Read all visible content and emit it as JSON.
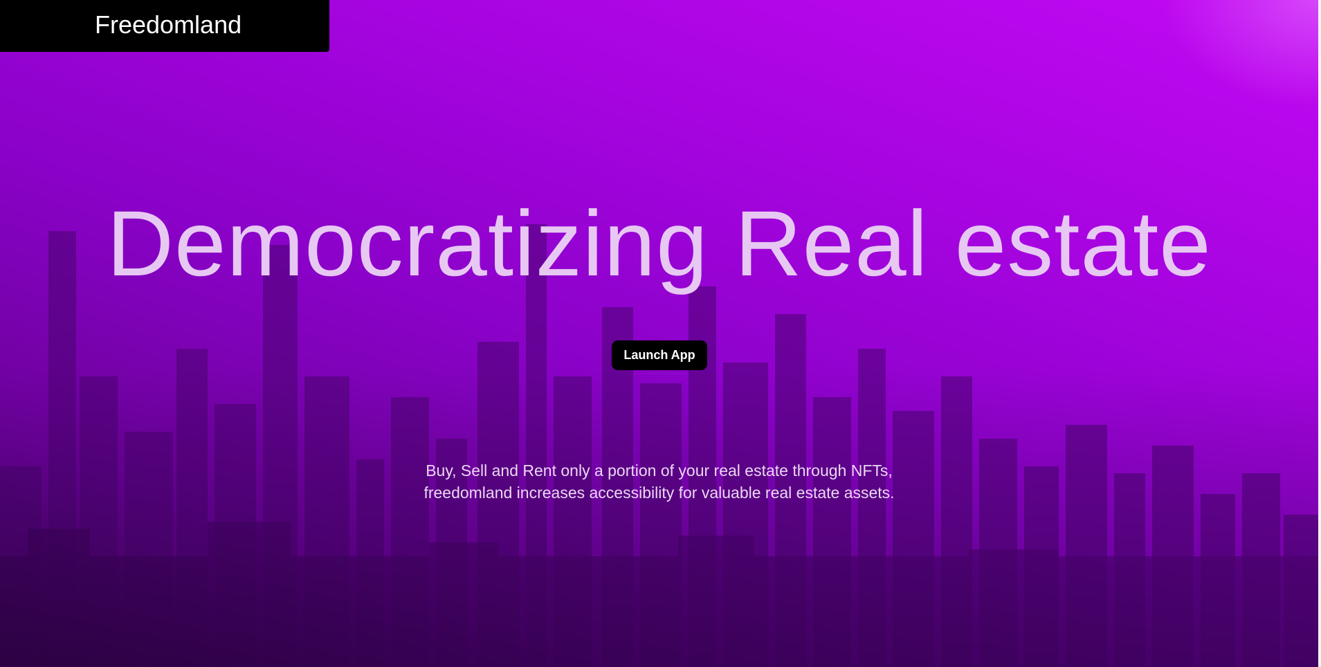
{
  "brand": {
    "name": "Freedomland"
  },
  "hero": {
    "headline": "Democratizing Real estate",
    "cta_label": "Launch App",
    "tagline_lines": [
      "Buy, Sell and Rent only a portion of your real estate through NFTs,",
      "freedomland increases accessibility for valuable real estate assets."
    ]
  },
  "colors": {
    "brand_bar": "#000000",
    "background_top_right": "#c209f3",
    "background_bottom_left": "#3e0457",
    "headline_text": "#e6c8f2",
    "button_bg": "#000000",
    "button_text": "#ffffff"
  },
  "background_image": {
    "icon": "city-skyline-image"
  }
}
